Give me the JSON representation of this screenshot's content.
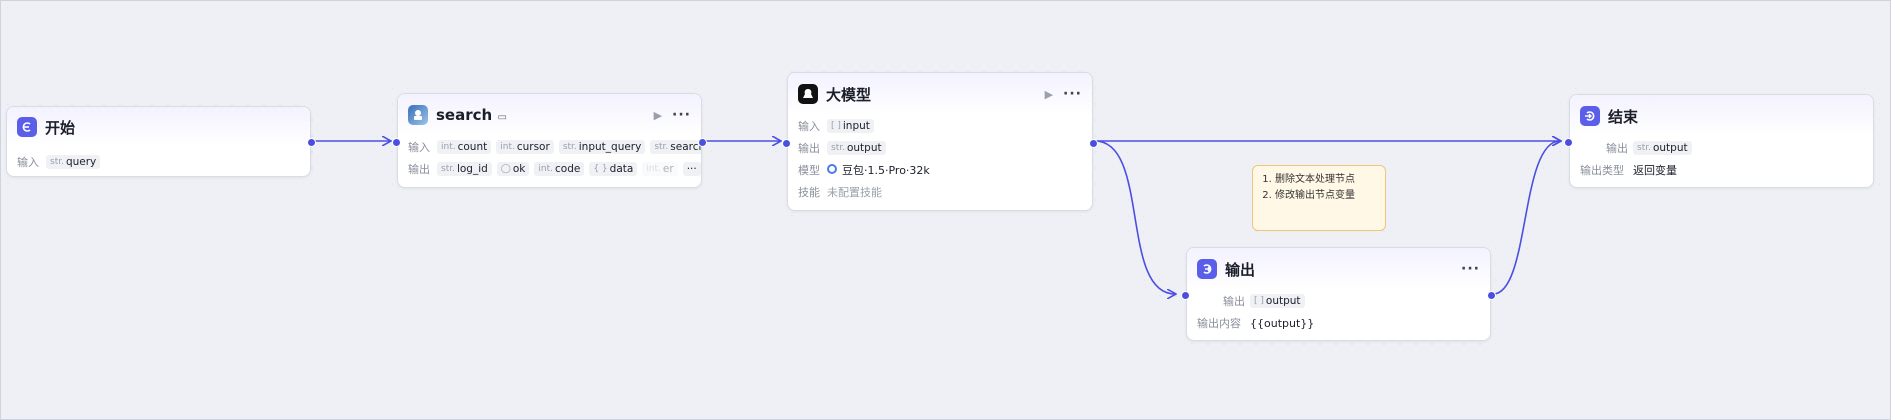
{
  "nodes": {
    "start": {
      "title": "开始",
      "input_label": "输入",
      "inputs": [
        {
          "type": "str.",
          "name": "query"
        }
      ]
    },
    "search": {
      "title": "search",
      "input_label": "输入",
      "inputs": [
        {
          "type": "int.",
          "name": "count"
        },
        {
          "type": "int.",
          "name": "cursor"
        },
        {
          "type": "str.",
          "name": "input_query"
        },
        {
          "type": "str.",
          "name": "search_id"
        }
      ],
      "output_label": "输出",
      "outputs": [
        {
          "type": "str.",
          "name": "log_id"
        },
        {
          "type": "◯",
          "name": "ok"
        },
        {
          "type": "int.",
          "name": "code"
        },
        {
          "type": "{ }",
          "name": "data"
        },
        {
          "type": "int.",
          "name": "er"
        }
      ],
      "more": "···"
    },
    "llm": {
      "title": "大模型",
      "input_label": "输入",
      "input": {
        "type": "[ ]",
        "name": "input"
      },
      "output_label": "输出",
      "output": {
        "type": "str.",
        "name": "output"
      },
      "model_label": "模型",
      "model_value": "豆包·1.5·Pro·32k",
      "skill_label": "技能",
      "skill_value": "未配置技能"
    },
    "output": {
      "title": "输出",
      "output_label": "输出",
      "output": {
        "type": "[ ]",
        "name": "output"
      },
      "content_label": "输出内容",
      "content_value": "{{output}}"
    },
    "end": {
      "title": "结束",
      "output_label": "输出",
      "output": {
        "type": "str.",
        "name": "output"
      },
      "type_label": "输出类型",
      "type_value": "返回变量"
    }
  },
  "note": {
    "items": [
      "删除文本处理节点",
      "修改输出节点变量"
    ]
  },
  "colors": {
    "accent": "#4b4fe0",
    "note_bg": "#fff8e6",
    "note_border": "#f2c47a"
  }
}
